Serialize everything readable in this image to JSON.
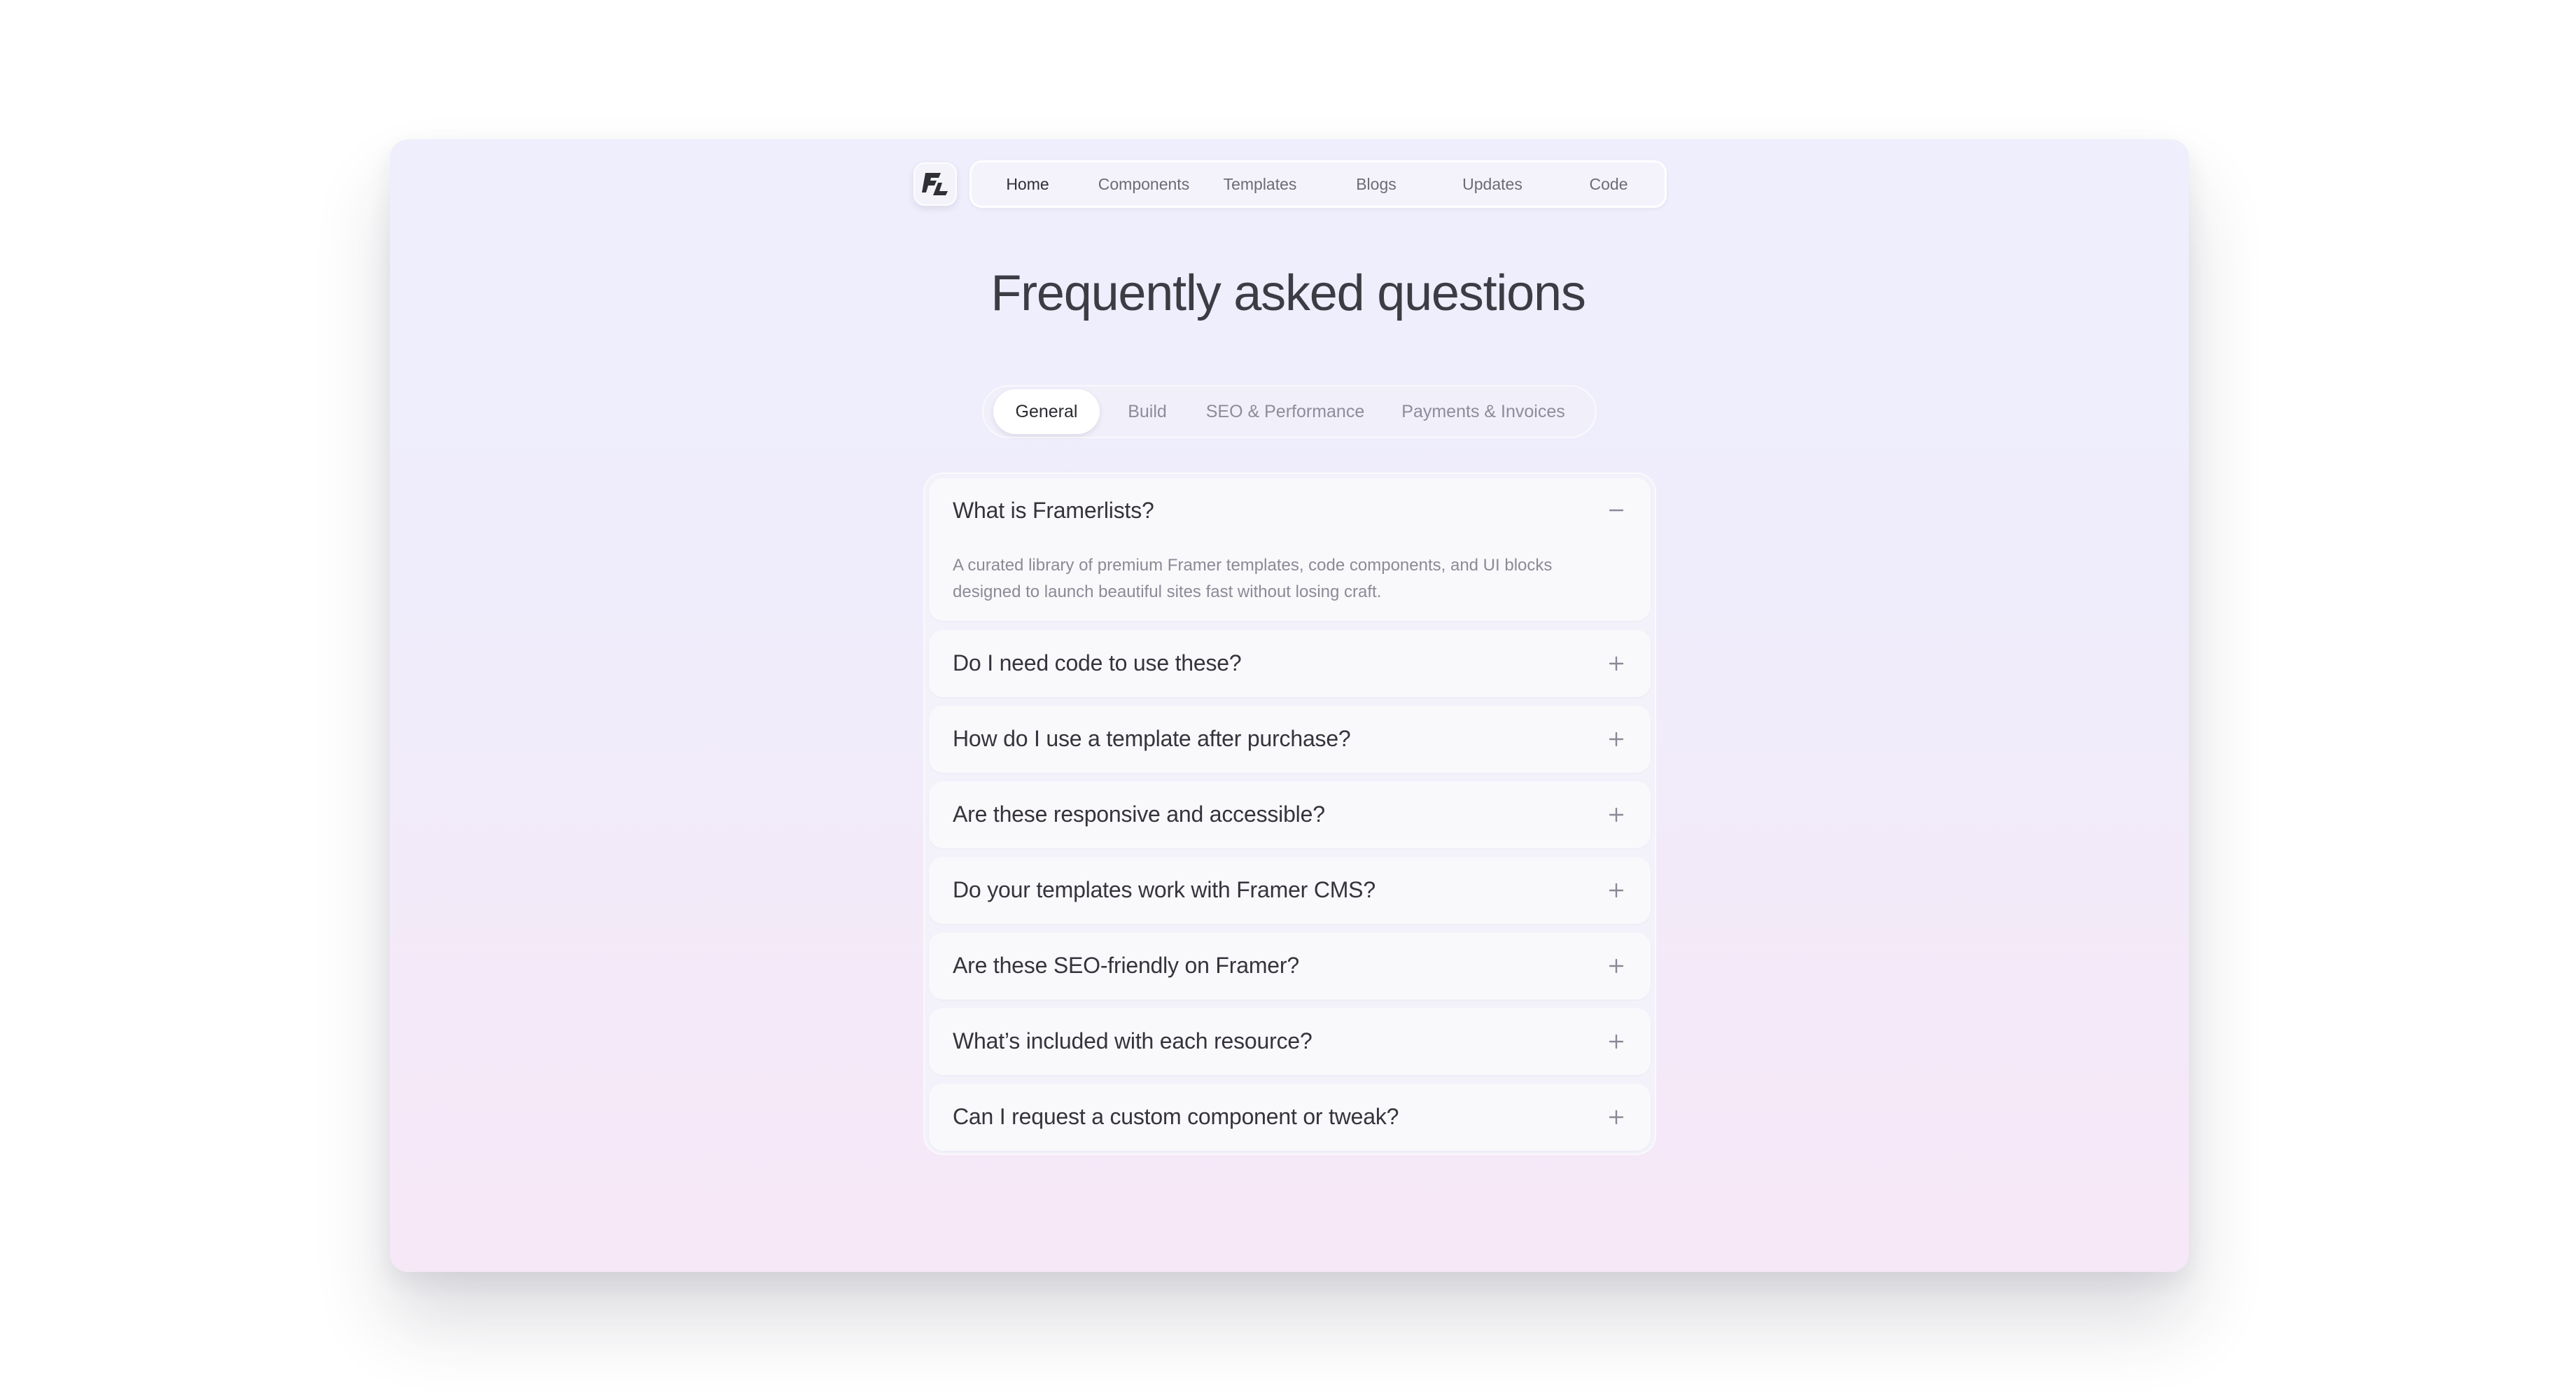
{
  "nav": {
    "logo_icon": "framerlists-logo-icon",
    "items": [
      {
        "label": "Home",
        "active": true
      },
      {
        "label": "Components",
        "active": false
      },
      {
        "label": "Templates",
        "active": false
      },
      {
        "label": "Blogs",
        "active": false
      },
      {
        "label": "Updates",
        "active": false
      },
      {
        "label": "Code",
        "active": false
      }
    ]
  },
  "page": {
    "title": "Frequently asked questions"
  },
  "tabs": [
    {
      "label": "General",
      "active": true
    },
    {
      "label": "Build",
      "active": false
    },
    {
      "label": "SEO & Performance",
      "active": false
    },
    {
      "label": "Payments & Invoices",
      "active": false
    }
  ],
  "faq": [
    {
      "question": "What is Framerlists?",
      "answer": "A curated library of premium Framer templates, code components, and UI blocks designed to launch beautiful sites fast without losing craft.",
      "expanded": true,
      "toggle_icon": "minus-icon"
    },
    {
      "question": "Do I need code to use these?",
      "expanded": false,
      "toggle_icon": "plus-icon"
    },
    {
      "question": "How do I use a template after purchase?",
      "expanded": false,
      "toggle_icon": "plus-icon"
    },
    {
      "question": "Are these responsive and accessible?",
      "expanded": false,
      "toggle_icon": "plus-icon"
    },
    {
      "question": "Do your templates work with Framer CMS?",
      "expanded": false,
      "toggle_icon": "plus-icon"
    },
    {
      "question": "Are these SEO-friendly on Framer?",
      "expanded": false,
      "toggle_icon": "plus-icon"
    },
    {
      "question": "What’s included with each resource?",
      "expanded": false,
      "toggle_icon": "plus-icon"
    },
    {
      "question": "Can I request a custom component or tweak?",
      "expanded": false,
      "toggle_icon": "plus-icon"
    }
  ],
  "colors": {
    "background_top": "#eeeefc",
    "background_bottom": "#f6e8f7",
    "text_primary": "#34343c",
    "text_muted": "#8b8a96"
  }
}
